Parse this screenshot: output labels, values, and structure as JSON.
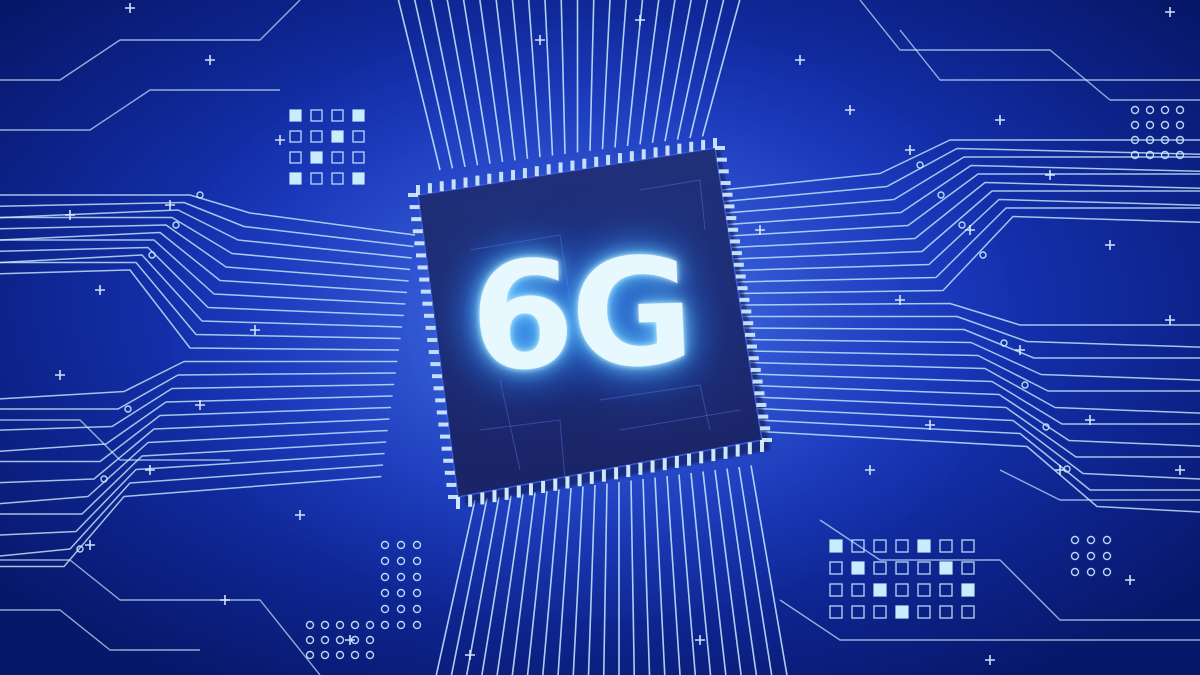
{
  "chip": {
    "label": "6G"
  },
  "colors": {
    "background": "#0a1d7a",
    "trace": "#c9ecff",
    "chip_body": "#1b2a6e",
    "glow": "#3aa8ff"
  }
}
